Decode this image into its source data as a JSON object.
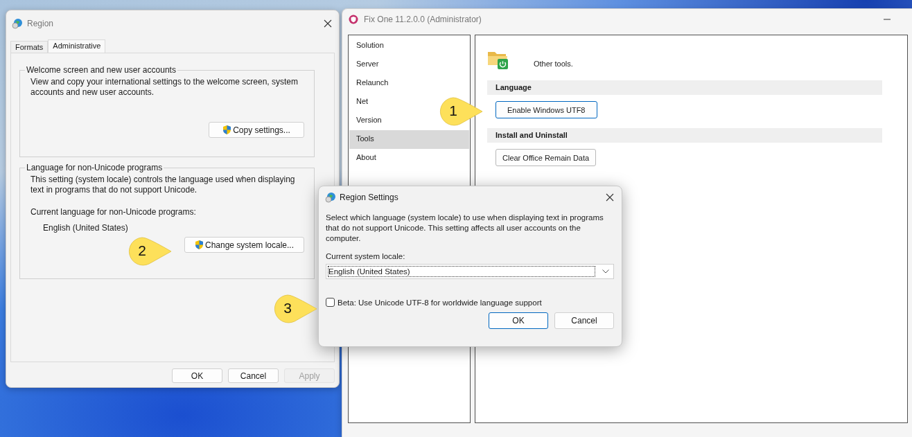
{
  "region_window": {
    "title": "Region",
    "tabs": [
      {
        "label": "Formats",
        "selected": false
      },
      {
        "label": "Administrative",
        "selected": true
      }
    ],
    "groups": [
      {
        "title": "Welcome screen and new user accounts",
        "description": "View and copy your international settings to the welcome screen, system accounts and new user accounts.",
        "button": "Copy settings..."
      },
      {
        "title": "Language for non-Unicode programs",
        "description": "This setting (system locale) controls the language used when displaying text in programs that do not support Unicode.",
        "current_label": "Current language for non-Unicode programs:",
        "current_value": "English (United States)",
        "button": "Change system locale..."
      }
    ],
    "buttons": [
      {
        "label": "OK",
        "disabled": false
      },
      {
        "label": "Cancel",
        "disabled": false
      },
      {
        "label": "Apply",
        "disabled": true
      }
    ]
  },
  "fix_one_window": {
    "title": "Fix One 11.2.0.0 (Administrator)",
    "sidebar": {
      "items": [
        {
          "label": "Solution",
          "selected": false
        },
        {
          "label": "Server",
          "selected": false
        },
        {
          "label": "Relaunch",
          "selected": false
        },
        {
          "label": "Net",
          "selected": false
        },
        {
          "label": "Version",
          "selected": false
        },
        {
          "label": "Tools",
          "selected": true
        },
        {
          "label": "About",
          "selected": false
        }
      ]
    },
    "content": {
      "heading": "Other tools.",
      "sections": [
        {
          "title": "Language",
          "buttons": [
            {
              "label": "Enable Windows UTF8",
              "focused": true
            }
          ]
        },
        {
          "title": "Install and Uninstall",
          "buttons": [
            {
              "label": "Clear Office Remain Data",
              "focused": false
            }
          ]
        }
      ]
    }
  },
  "region_settings_dialog": {
    "title": "Region Settings",
    "description": "Select which language (system locale) to use when displaying text in programs that do not support Unicode. This setting affects all user accounts on the computer.",
    "locale_label": "Current system locale:",
    "locale_value": "English (United States)",
    "checkbox": {
      "label": "Beta: Use Unicode UTF-8 for worldwide language support",
      "checked": false
    },
    "buttons": [
      {
        "label": "OK",
        "focused": true
      },
      {
        "label": "Cancel",
        "focused": false
      }
    ]
  },
  "callouts": [
    {
      "number": "1"
    },
    {
      "number": "2"
    },
    {
      "number": "3"
    }
  ]
}
